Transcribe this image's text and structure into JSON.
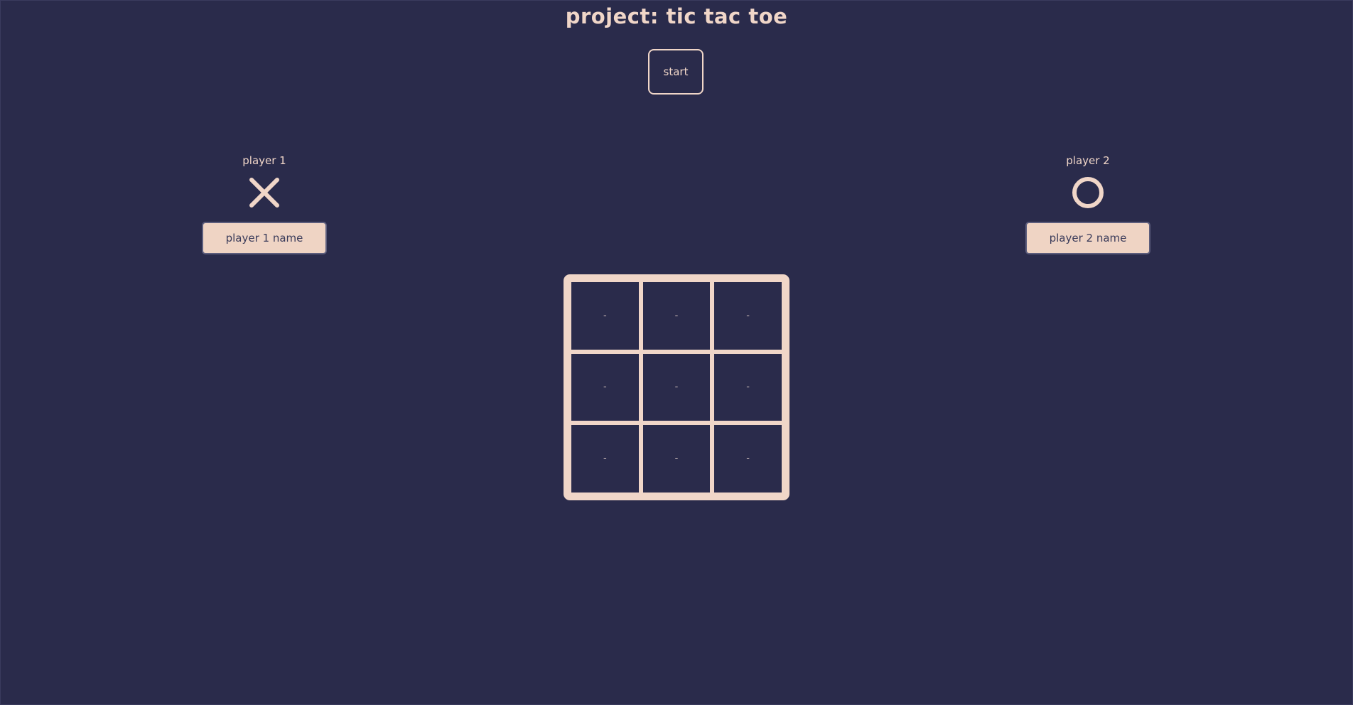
{
  "header": {
    "title": "project: tic tac toe",
    "start_label": "start"
  },
  "players": [
    {
      "label": "player 1",
      "symbol_icon": "x-icon",
      "name_button": "player 1 name"
    },
    {
      "label": "player 2",
      "symbol_icon": "o-icon",
      "name_button": "player 2 name"
    }
  ],
  "board": {
    "cells": [
      "-",
      "-",
      "-",
      "-",
      "-",
      "-",
      "-",
      "-",
      "-"
    ]
  },
  "colors": {
    "background": "#2a2b4b",
    "accent": "#f0d6c8"
  }
}
